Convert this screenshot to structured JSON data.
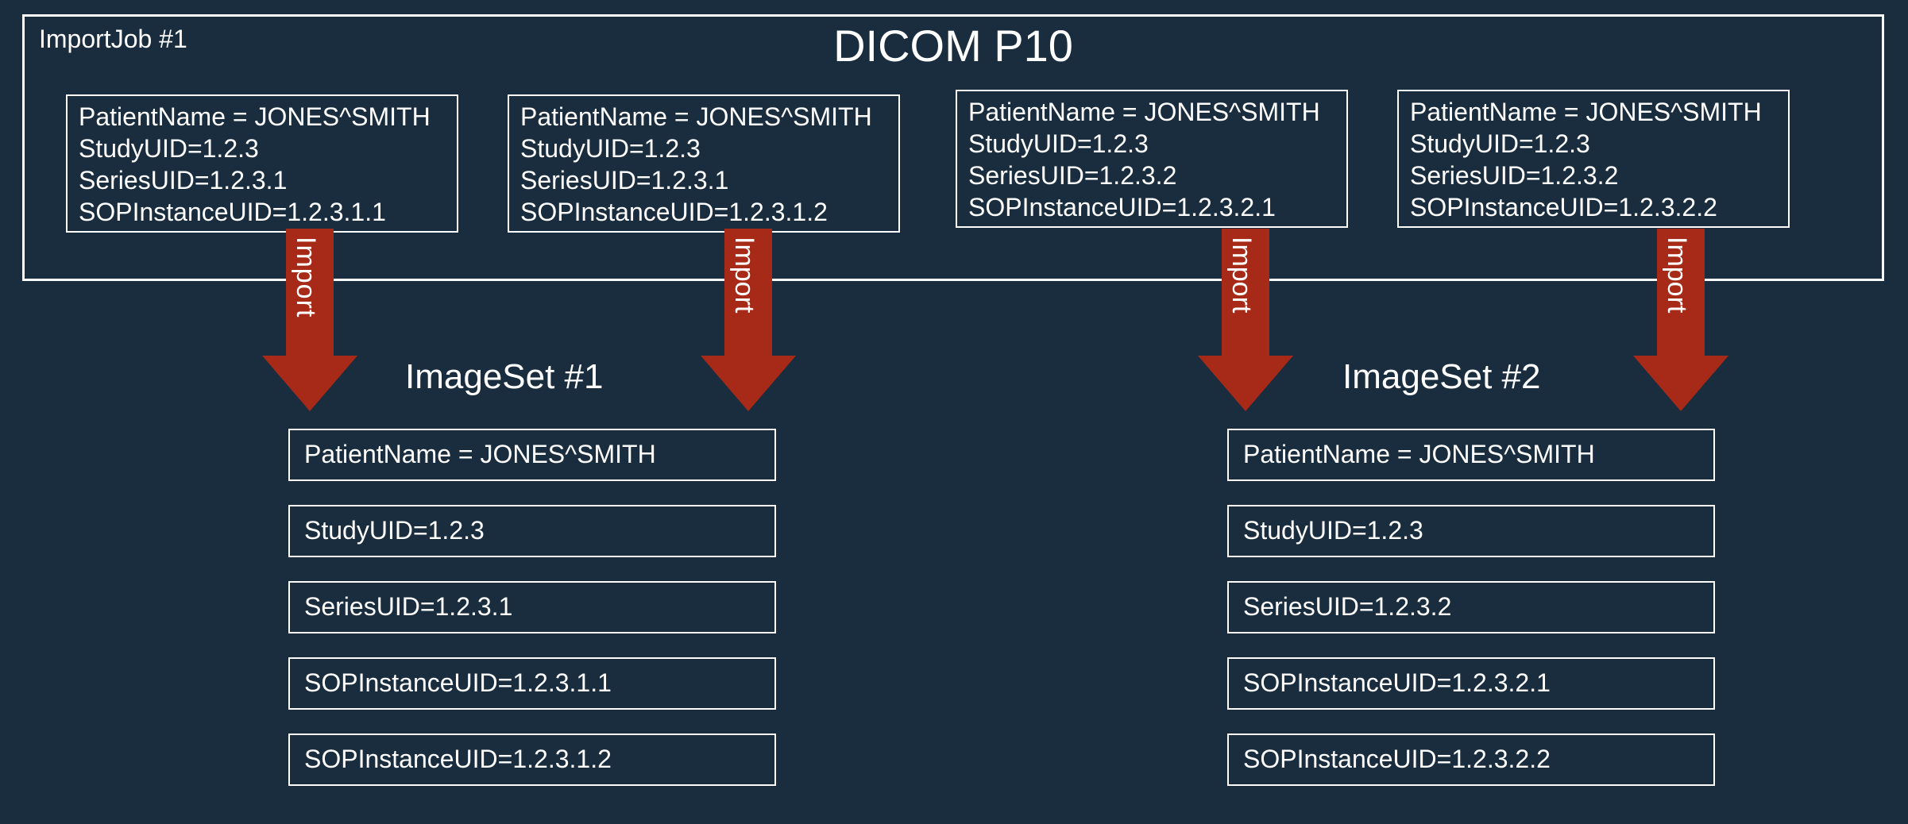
{
  "header": {
    "importJob": "ImportJob #1",
    "title": "DICOM P10"
  },
  "sources": [
    {
      "patient": "PatientName = JONES^SMITH",
      "study": "StudyUID=1.2.3",
      "series": "SeriesUID=1.2.3.1",
      "sop": "SOPInstanceUID=1.2.3.1.1"
    },
    {
      "patient": "PatientName = JONES^SMITH",
      "study": "StudyUID=1.2.3",
      "series": "SeriesUID=1.2.3.1",
      "sop": "SOPInstanceUID=1.2.3.1.2"
    },
    {
      "patient": "PatientName = JONES^SMITH",
      "study": "StudyUID=1.2.3",
      "series": "SeriesUID=1.2.3.2",
      "sop": "SOPInstanceUID=1.2.3.2.1"
    },
    {
      "patient": "PatientName = JONES^SMITH",
      "study": "StudyUID=1.2.3",
      "series": "SeriesUID=1.2.3.2",
      "sop": "SOPInstanceUID=1.2.3.2.2"
    }
  ],
  "arrowLabel": "Import",
  "imageSets": {
    "label1": "ImageSet #1",
    "label2": "ImageSet #2"
  },
  "set1": {
    "r0": "PatientName = JONES^SMITH",
    "r1": "StudyUID=1.2.3",
    "r2": "SeriesUID=1.2.3.1",
    "r3": "SOPInstanceUID=1.2.3.1.1",
    "r4": "SOPInstanceUID=1.2.3.1.2"
  },
  "set2": {
    "r0": "PatientName = JONES^SMITH",
    "r1": "StudyUID=1.2.3",
    "r2": "SeriesUID=1.2.3.2",
    "r3": "SOPInstanceUID=1.2.3.2.1",
    "r4": "SOPInstanceUID=1.2.3.2.2"
  },
  "colors": {
    "arrow": "#a62a17",
    "bg": "#192d3e",
    "border": "#ffffff"
  }
}
